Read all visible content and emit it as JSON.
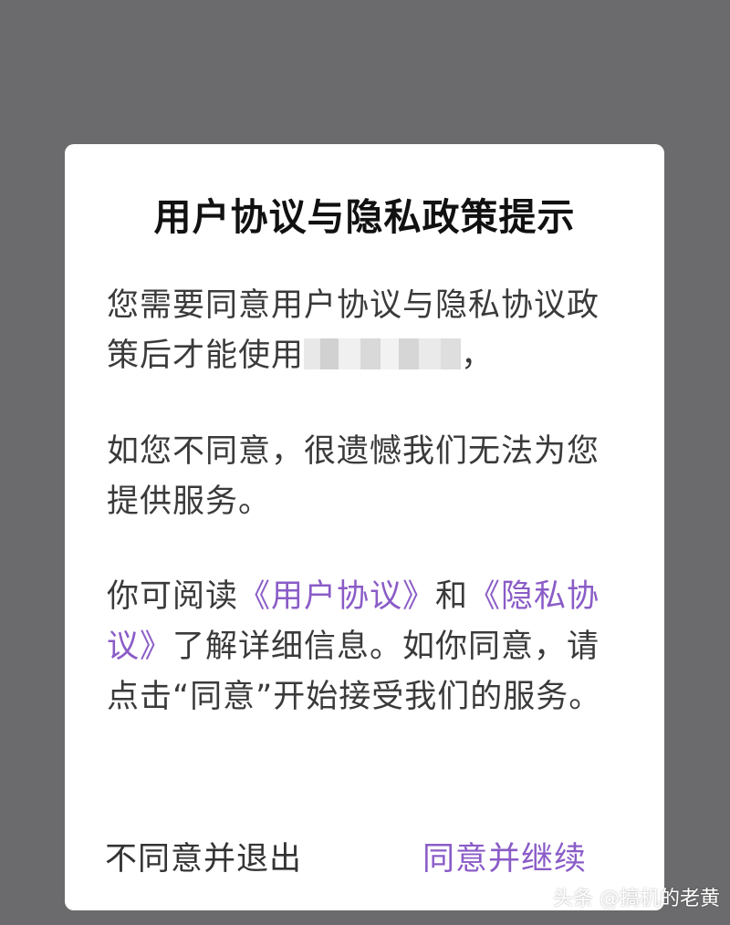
{
  "dialog": {
    "title": "用户协议与隐私政策提示",
    "paragraph1": {
      "text_before": "您需要同意用户协议与隐私协议政策后才能使用",
      "text_after": "，"
    },
    "paragraph2": "如您不同意，很遗憾我们无法为您提供服务。",
    "paragraph3": {
      "part1": "你可阅读",
      "link_user_agreement": "《用户协议》",
      "part2": "和",
      "link_privacy_agreement": "《隐私协议》",
      "part3": "了解详细信息。如你同意，请点击“同意”开始接受我们的服务。"
    },
    "actions": {
      "decline_label": "不同意并退出",
      "agree_label": "同意并继续"
    }
  },
  "watermark": "头条 @搞机的老黄",
  "colors": {
    "accent": "#8a5cc7",
    "backdrop": "#6b6b6d",
    "dialog_bg": "#ffffff"
  }
}
